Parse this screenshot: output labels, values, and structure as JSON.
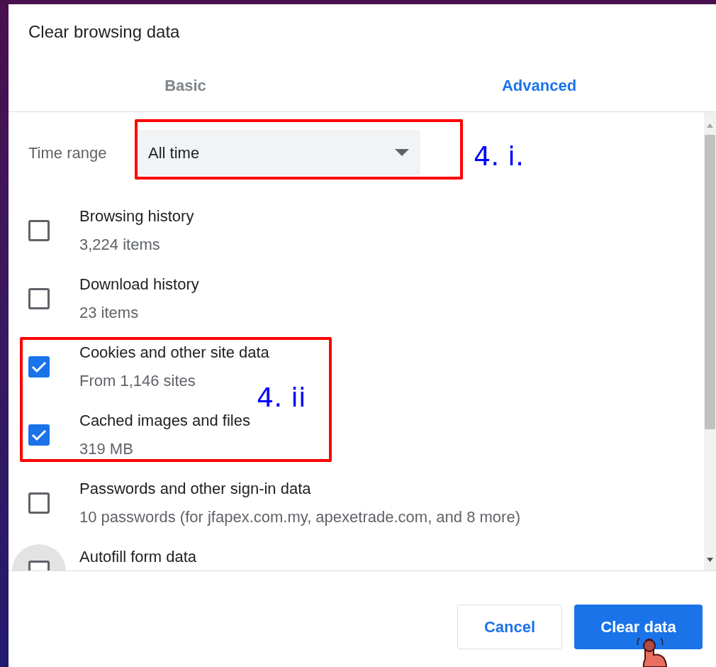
{
  "dialog": {
    "title": "Clear browsing data"
  },
  "tabs": [
    {
      "label": "Basic",
      "selected": false
    },
    {
      "label": "Advanced",
      "selected": true
    }
  ],
  "time_range": {
    "label": "Time range",
    "value": "All time"
  },
  "items": [
    {
      "title": "Browsing history",
      "detail": "3,224 items",
      "checked": false,
      "focused": false
    },
    {
      "title": "Download history",
      "detail": "23 items",
      "checked": false,
      "focused": false
    },
    {
      "title": "Cookies and other site data",
      "detail": "From 1,146 sites",
      "checked": true,
      "focused": false
    },
    {
      "title": "Cached images and files",
      "detail": "319 MB",
      "checked": true,
      "focused": false
    },
    {
      "title": "Passwords and other sign-in data",
      "detail": "10 passwords (for jfapex.com.my, apexetrade.com, and 8 more)",
      "checked": false,
      "focused": false
    },
    {
      "title": "Autofill form data",
      "checked": false,
      "focused": true
    }
  ],
  "buttons": [
    {
      "label": "Cancel",
      "kind": "secondary"
    },
    {
      "label": "Clear data",
      "kind": "primary"
    }
  ],
  "annotations": [
    {
      "label": "4. i."
    },
    {
      "label": "4. ii"
    }
  ]
}
